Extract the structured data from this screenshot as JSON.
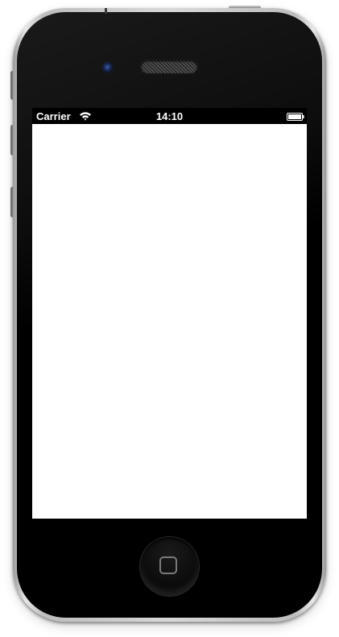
{
  "device": {
    "model_icons": {
      "camera": "front-camera-icon",
      "speaker": "earpiece-speaker-icon",
      "home": "home-button-icon"
    },
    "colors": {
      "bezel": "#000000",
      "frame": "#c8c8c8",
      "screen_background": "#ffffff",
      "status_bar": "#000000",
      "status_text": "#ffffff"
    }
  },
  "status_bar": {
    "carrier": "Carrier",
    "time": "14:10",
    "wifi_icon": "wifi-icon",
    "battery_icon": "battery-icon",
    "battery_level": 1.0
  },
  "screen": {
    "content": ""
  }
}
